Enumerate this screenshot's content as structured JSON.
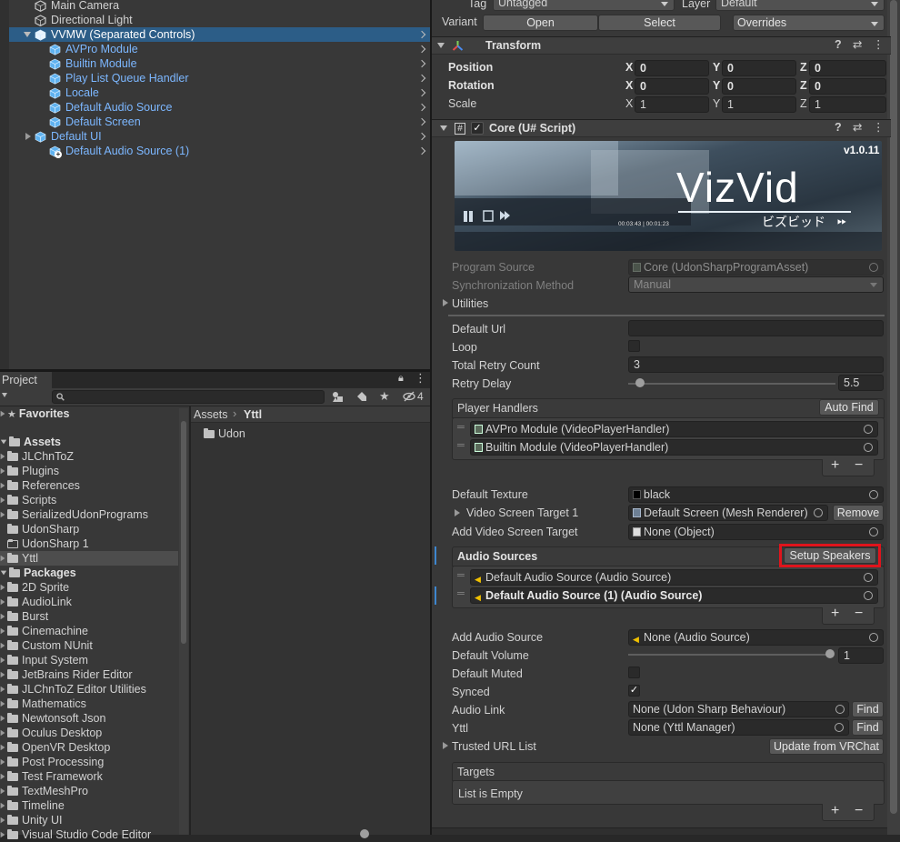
{
  "hierarchy": {
    "items": [
      {
        "label": "Main Camera",
        "type": "gameobject",
        "prefab": false,
        "expander": "none",
        "selected": false
      },
      {
        "label": "Directional Light",
        "type": "gameobject",
        "prefab": false,
        "expander": "none",
        "selected": false
      },
      {
        "label": "VVMW (Separated Controls)",
        "type": "prefab",
        "prefab": true,
        "expander": "expanded",
        "selected": true
      },
      {
        "label": "AVPro Module",
        "type": "prefab",
        "prefab": true,
        "expander": "none",
        "selected": false
      },
      {
        "label": "Builtin Module",
        "type": "prefab",
        "prefab": true,
        "expander": "none",
        "selected": false
      },
      {
        "label": "Play List Queue Handler",
        "type": "prefab",
        "prefab": true,
        "expander": "none",
        "selected": false
      },
      {
        "label": "Locale",
        "type": "prefab",
        "prefab": true,
        "expander": "none",
        "selected": false
      },
      {
        "label": "Default Audio Source",
        "type": "prefab",
        "prefab": true,
        "expander": "none",
        "selected": false
      },
      {
        "label": "Default Screen",
        "type": "prefab",
        "prefab": true,
        "expander": "none",
        "selected": false
      },
      {
        "label": "Default UI",
        "type": "prefab",
        "prefab": true,
        "expander": "collapsed",
        "selected": false
      },
      {
        "label": "Default Audio Source (1)",
        "type": "prefab-added",
        "prefab": true,
        "expander": "none",
        "selected": false
      }
    ]
  },
  "project": {
    "tab_label": "Project",
    "hidden_count": "4",
    "breadcrumb": {
      "root": "Assets",
      "current": "Yttl"
    },
    "files": [
      {
        "label": "Udon"
      }
    ],
    "favorites_label": "Favorites",
    "assets_label": "Assets",
    "asset_folders": [
      "JLChnToZ",
      "Plugins",
      "References",
      "Scripts",
      "SerializedUdonPrograms",
      "UdonSharp",
      "UdonSharp 1",
      "Yttl"
    ],
    "packages_label": "Packages",
    "package_folders": [
      "2D Sprite",
      "AudioLink",
      "Burst",
      "Cinemachine",
      "Custom NUnit",
      "Input System",
      "JetBrains Rider Editor",
      "JLChnToZ Editor Utilities",
      "Mathematics",
      "Newtonsoft Json",
      "Oculus Desktop",
      "OpenVR Desktop",
      "Post Processing",
      "Test Framework",
      "TextMeshPro",
      "Timeline",
      "Unity UI",
      "Visual Studio Code Editor"
    ]
  },
  "inspector": {
    "tag_label": "Tag",
    "tag_value": "Untagged",
    "layer_label": "Layer",
    "layer_value": "Default",
    "variant_label": "Variant",
    "open_label": "Open",
    "select_label": "Select",
    "overrides_label": "Overrides",
    "transform": {
      "title": "Transform",
      "position_label": "Position",
      "rotation_label": "Rotation",
      "scale_label": "Scale",
      "axis_x": "X",
      "axis_y": "Y",
      "axis_z": "Z",
      "position": [
        "0",
        "0",
        "0"
      ],
      "rotation": [
        "0",
        "0",
        "0"
      ],
      "scale": [
        "1",
        "1",
        "1"
      ]
    },
    "core": {
      "title": "Core (U# Script)",
      "banner_version": "v1.0.11",
      "banner_brand": "VizVid",
      "banner_subtitle": "ビズビッド",
      "banner_time": "00:03:43 | 00:01:23",
      "program_source_label": "Program Source",
      "program_source_value": "Core (UdonSharpProgramAsset)",
      "sync_method_label": "Synchronization Method",
      "sync_method_value": "Manual",
      "utilities_label": "Utilities",
      "default_url_label": "Default Url",
      "default_url_value": "",
      "loop_label": "Loop",
      "total_retry_label": "Total Retry Count",
      "total_retry_value": "3",
      "retry_delay_label": "Retry Delay",
      "retry_delay_value": "5.5",
      "retry_delay_fraction": 0.03,
      "player_handlers_label": "Player Handlers",
      "auto_find_label": "Auto Find",
      "player_handlers": [
        "AVPro Module (VideoPlayerHandler)",
        "Builtin Module (VideoPlayerHandler)"
      ],
      "default_texture_label": "Default Texture",
      "default_texture_value": "black",
      "video_screen_target_label": "Video Screen Target 1",
      "video_screen_target_value": "Default Screen (Mesh Renderer)",
      "remove_label": "Remove",
      "add_video_screen_label": "Add Video Screen Target",
      "add_video_screen_value": "None (Object)",
      "audio_sources_label": "Audio Sources",
      "setup_speakers_label": "Setup Speakers",
      "audio_sources": [
        "Default Audio Source (Audio Source)",
        "Default Audio Source (1) (Audio Source)"
      ],
      "add_audio_source_label": "Add Audio Source",
      "add_audio_source_value": "None (Audio Source)",
      "default_volume_label": "Default Volume",
      "default_volume_value": "1",
      "default_volume_fraction": 1.0,
      "default_muted_label": "Default Muted",
      "synced_label": "Synced",
      "audio_link_label": "Audio Link",
      "audio_link_value": "None (Udon Sharp Behaviour)",
      "find_label": "Find",
      "yttl_label": "Yttl",
      "yttl_value": "None (Yttl Manager)",
      "trusted_url_label": "Trusted URL List",
      "update_vrchat_label": "Update from VRChat",
      "targets_label": "Targets",
      "targets_empty": "List is Empty",
      "plus": "+",
      "minus": "−"
    }
  },
  "colors": {
    "selection": "#2c5d87",
    "prefab_text": "#7cb7ff",
    "highlight_box": "#e0141c"
  }
}
